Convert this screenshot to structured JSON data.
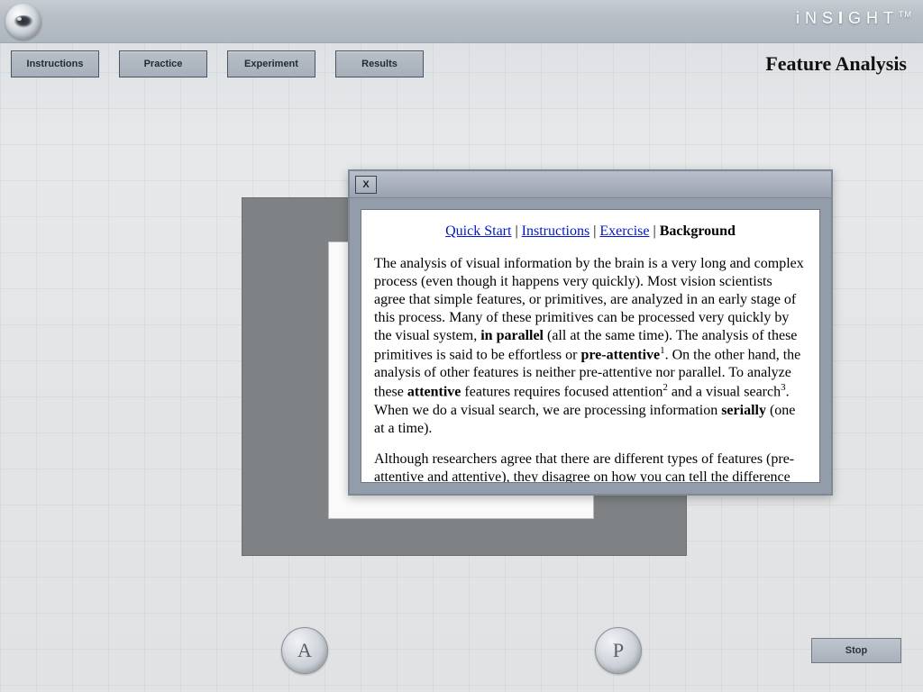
{
  "brand": {
    "name": "iNSIGHT",
    "tm": "TM"
  },
  "nav": {
    "instructions": "Instructions",
    "practice": "Practice",
    "experiment": "Experiment",
    "results": "Results"
  },
  "page_title": "Feature Analysis",
  "popup": {
    "close_label": "X",
    "tabs": {
      "quick_start": "Quick Start",
      "instructions": "Instructions",
      "exercise": "Exercise",
      "background": "Background",
      "sep": " | "
    },
    "para1_a": "The analysis of visual information by the brain is a very long and complex process (even though it happens very quickly). Most vision scientists agree that simple features, or primitives, are analyzed in an early stage of this process. Many of these primitives can be processed very quickly by the visual system, ",
    "para1_bold1": "in parallel",
    "para1_b": " (all at the same time). The analysis of these primitives is said to be effortless or ",
    "para1_bold2": "pre-attentive",
    "para1_sup1": "1",
    "para1_c": ". On the other hand, the analysis of other features is neither pre-attentive nor parallel. To analyze these ",
    "para1_bold3": "attentive",
    "para1_d": " features requires focused attention",
    "para1_sup2": "2",
    "para1_e": " and a visual search",
    "para1_sup3": "3",
    "para1_f": ". When we do a visual search, we are processing information ",
    "para1_bold4": "serially",
    "para1_g": " (one at a time).",
    "para2": "Although researchers agree that there are different types of features (pre-attentive and attentive), they disagree on how you can tell the difference between these types. For example, it is very easy to tell the difference"
  },
  "bottom": {
    "a": "A",
    "p": "P",
    "stop": "Stop"
  }
}
